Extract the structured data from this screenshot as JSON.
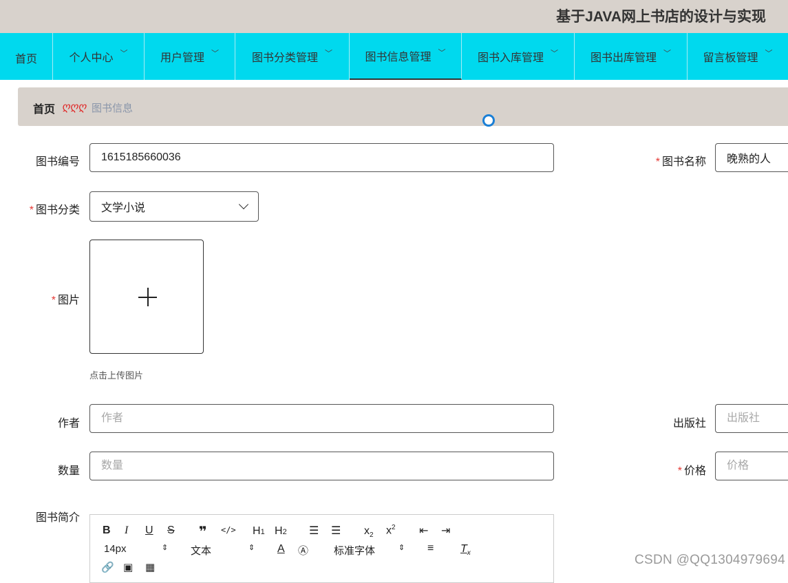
{
  "header": {
    "title": "基于JAVA网上书店的设计与实现"
  },
  "nav": {
    "items": [
      {
        "label": "首页",
        "dropdown": false
      },
      {
        "label": "个人中心",
        "dropdown": true
      },
      {
        "label": "用户管理",
        "dropdown": true
      },
      {
        "label": "图书分类管理",
        "dropdown": true
      },
      {
        "label": "图书信息管理",
        "dropdown": true,
        "active": true
      },
      {
        "label": "图书入库管理",
        "dropdown": true
      },
      {
        "label": "图书出库管理",
        "dropdown": true
      },
      {
        "label": "留言板管理",
        "dropdown": true
      }
    ]
  },
  "breadcrumb": {
    "home": "首页",
    "separator": "ღღღ",
    "current": "图书信息"
  },
  "form": {
    "book_no": {
      "label": "图书编号",
      "value": "1615185660036"
    },
    "book_name": {
      "label": "图书名称",
      "required": "*",
      "value": "晚熟的人"
    },
    "category": {
      "label": "图书分类",
      "required": "*",
      "value": "文学小说"
    },
    "image": {
      "label": "图片",
      "required": "*",
      "tip": "点击上传图片"
    },
    "author": {
      "label": "作者",
      "placeholder": "作者"
    },
    "publisher": {
      "label": "出版社",
      "placeholder": "出版社"
    },
    "quantity": {
      "label": "数量",
      "placeholder": "数量"
    },
    "price": {
      "label": "价格",
      "required": "*",
      "placeholder": "价格"
    },
    "intro": {
      "label": "图书简介"
    }
  },
  "editor": {
    "font_size": "14px",
    "text_type": "文本",
    "font_family": "标准字体"
  },
  "watermark": "CSDN @QQ1304979694",
  "colors": {
    "nav_bg": "#00d9ee",
    "header_bg": "#d8d2cc",
    "required": "#e53935"
  }
}
